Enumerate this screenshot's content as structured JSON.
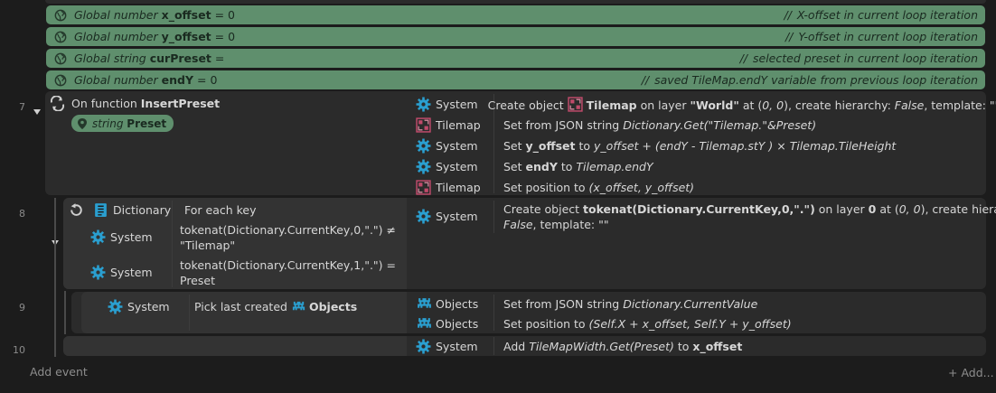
{
  "globals": [
    {
      "kind": "Global number",
      "name": "x_offset",
      "eq": "=",
      "value": "0",
      "comment": "X-offset in current loop iteration"
    },
    {
      "kind": "Global number",
      "name": "y_offset",
      "eq": "=",
      "value": "0",
      "comment": "Y-offset in current loop iteration"
    },
    {
      "kind": "Global string",
      "name": "curPreset",
      "eq": "=",
      "value": "",
      "comment": "selected preset in current loop iteration"
    },
    {
      "kind": "Global number",
      "name": "endY",
      "eq": "=",
      "value": "0",
      "comment": "saved TileMap.endY variable from previous loop iteration"
    }
  ],
  "comment_slashes": "//",
  "line_numbers": [
    "7",
    "8",
    "9",
    "10"
  ],
  "event7": {
    "trigger_prefix": "On function",
    "trigger_name": "InsertPreset",
    "param_type": "string",
    "param_name": "Preset",
    "actions": [
      {
        "object": "System",
        "parts": [
          "Create object ",
          "Tilemap",
          " on layer ",
          "\"World\"",
          " at (",
          "0, 0",
          "), create hierarchy: ",
          "False",
          ", template: \"\""
        ]
      },
      {
        "object": "Tilemap",
        "parts": [
          "Set from JSON string ",
          "Dictionary.Get(\"Tilemap.\"&Preset)"
        ]
      },
      {
        "object": "System",
        "parts": [
          "Set ",
          "y_offset",
          " to ",
          "y_offset + (endY - Tilemap.stY ) × Tilemap.TileHeight"
        ]
      },
      {
        "object": "System",
        "parts": [
          "Set ",
          "endY",
          " to ",
          "Tilemap.endY"
        ]
      },
      {
        "object": "Tilemap",
        "parts": [
          "Set position to ",
          "(x_offset, y_offset)"
        ]
      }
    ]
  },
  "event8": {
    "conditions": [
      {
        "object": "Dictionary",
        "text": "For each key"
      },
      {
        "object": "System",
        "line1": "tokenat(Dictionary.CurrentKey,0,\".\") ≠",
        "line2": "\"Tilemap\""
      },
      {
        "object": "System",
        "line1": "tokenat(Dictionary.CurrentKey,1,\".\") =",
        "line2": "Preset"
      }
    ],
    "action": {
      "object": "System",
      "parts": [
        "Create object ",
        "tokenat(Dictionary.CurrentKey,0,\".\")",
        " on layer ",
        "0",
        " at (",
        "0, 0",
        "), create hierarchy:"
      ],
      "line2_parts": [
        "False",
        ", template: \"\""
      ]
    }
  },
  "event9": {
    "condition": {
      "object": "System",
      "text": "Pick last created",
      "target": "Objects"
    },
    "actions": [
      {
        "object": "Objects",
        "parts": [
          "Set from JSON string ",
          "Dictionary.CurrentValue"
        ]
      },
      {
        "object": "Objects",
        "parts": [
          "Set position to ",
          "(Self.X + x_offset, Self.Y + y_offset)"
        ]
      }
    ]
  },
  "event10": {
    "action": {
      "object": "System",
      "parts": [
        "Add ",
        "TileMapWidth.Get(Preset)",
        " to ",
        "x_offset"
      ]
    }
  },
  "footer": {
    "add_event": "Add event",
    "add_more": "Add..."
  },
  "colors": {
    "global_bar": "#5f8f6d",
    "event_bg": "#2b2b2b",
    "system_icon": "#2a9fd0",
    "tilemap_icon": "#c04a6a",
    "objects_icon": "#2a9fd0"
  }
}
